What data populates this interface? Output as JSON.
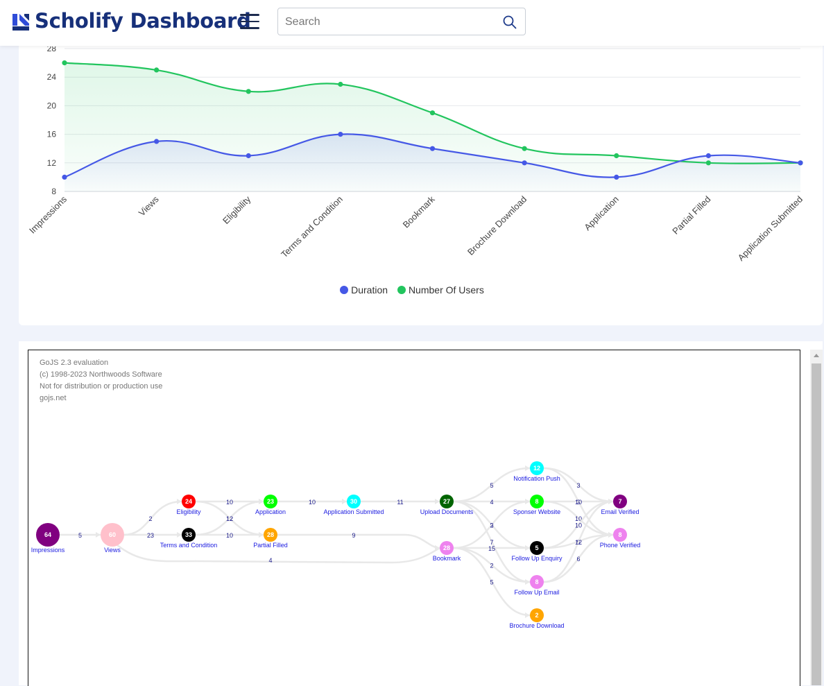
{
  "header": {
    "brand": "Scholify Dashboard",
    "search_placeholder": "Search",
    "icons": [
      "logo-icon",
      "menu-icon",
      "search-icon"
    ]
  },
  "chart_data": {
    "type": "area",
    "categories": [
      "Impressions",
      "Views",
      "Eligibility",
      "Terms and Condition",
      "Bookmark",
      "Brochure Download",
      "Application",
      "Partial Filled",
      "Application Submitted"
    ],
    "series": [
      {
        "name": "Duration",
        "color": "#4558e6",
        "values": [
          10,
          15,
          13,
          16,
          14,
          12,
          10,
          13,
          12
        ]
      },
      {
        "name": "Number Of Users",
        "color": "#22c55e",
        "values": [
          26,
          25,
          22,
          23,
          19,
          14,
          13,
          12,
          12
        ]
      }
    ],
    "y_ticks": [
      "8",
      "12",
      "16",
      "20",
      "24",
      "28"
    ],
    "ylim": [
      8,
      28
    ],
    "grid": true,
    "legend": "bottom",
    "smooth": true
  },
  "diagram": {
    "eval_note": [
      "GoJS 2.3 evaluation",
      "(c) 1998-2023 Northwoods Software",
      "Not for distribution or production use",
      "gojs.net"
    ],
    "nodes": [
      {
        "id": "impressions",
        "label": "Impressions",
        "value": "64",
        "color": "#800080",
        "big": true
      },
      {
        "id": "views",
        "label": "Views",
        "value": "60",
        "color": "#ffc0cb",
        "big": true
      },
      {
        "id": "eligibility",
        "label": "Eligibility",
        "value": "24",
        "color": "#ff0000"
      },
      {
        "id": "terms",
        "label": "Terms and Condition",
        "value": "33",
        "color": "#000000"
      },
      {
        "id": "application",
        "label": "Application",
        "value": "23",
        "color": "#00ff00"
      },
      {
        "id": "partial",
        "label": "Partial Filled",
        "value": "28",
        "color": "#ffa500"
      },
      {
        "id": "appsub",
        "label": "Application Submitted",
        "value": "30",
        "color": "#00ffff"
      },
      {
        "id": "upload",
        "label": "Upload Documents",
        "value": "27",
        "color": "#006400"
      },
      {
        "id": "bookmark",
        "label": "Bookmark",
        "value": "28",
        "color": "#ee82ee"
      },
      {
        "id": "notif",
        "label": "Notification Push",
        "value": "12",
        "color": "#00ffff"
      },
      {
        "id": "sponser",
        "label": "Sponser Website",
        "value": "8",
        "color": "#00ff00"
      },
      {
        "id": "followenq",
        "label": "Follow Up Enquiry",
        "value": "5",
        "color": "#000000"
      },
      {
        "id": "followemail",
        "label": "Follow Up Email",
        "value": "8",
        "color": "#ee82ee"
      },
      {
        "id": "brochure",
        "label": "Brochure Download",
        "value": "2",
        "color": "#ffa500"
      },
      {
        "id": "emailver",
        "label": "Email Verified",
        "value": "7",
        "color": "#800080"
      },
      {
        "id": "phonever",
        "label": "Phone Verified",
        "value": "8",
        "color": "#ee82ee"
      }
    ],
    "links": [
      {
        "from": "impressions",
        "to": "views",
        "value": "5"
      },
      {
        "from": "views",
        "to": "eligibility",
        "value": "2"
      },
      {
        "from": "views",
        "to": "terms",
        "value": "23"
      },
      {
        "from": "views",
        "to": "bookmark",
        "value": "4"
      },
      {
        "from": "eligibility",
        "to": "application",
        "value": "10"
      },
      {
        "from": "eligibility",
        "to": "partial",
        "value": "12"
      },
      {
        "from": "terms",
        "to": "application",
        "value": "12"
      },
      {
        "from": "terms",
        "to": "partial",
        "value": "10"
      },
      {
        "from": "application",
        "to": "appsub",
        "value": "10"
      },
      {
        "from": "partial",
        "to": "bookmark",
        "value": "9"
      },
      {
        "from": "appsub",
        "to": "upload",
        "value": "11"
      },
      {
        "from": "upload",
        "to": "notif",
        "value": "5"
      },
      {
        "from": "upload",
        "to": "sponser",
        "value": "4"
      },
      {
        "from": "upload",
        "to": "followenq",
        "value": "8"
      },
      {
        "from": "upload",
        "to": "followemail",
        "value": "7"
      },
      {
        "from": "bookmark",
        "to": "sponser",
        "value": "2"
      },
      {
        "from": "bookmark",
        "to": "followenq",
        "value": "15"
      },
      {
        "from": "bookmark",
        "to": "followemail",
        "value": "2"
      },
      {
        "from": "bookmark",
        "to": "brochure",
        "value": "5"
      },
      {
        "from": "notif",
        "to": "emailver",
        "value": "3"
      },
      {
        "from": "notif",
        "to": "phonever",
        "value": "9"
      },
      {
        "from": "sponser",
        "to": "emailver",
        "value": "10"
      },
      {
        "from": "sponser",
        "to": "phonever",
        "value": "10"
      },
      {
        "from": "followenq",
        "to": "emailver",
        "value": "10"
      },
      {
        "from": "followenq",
        "to": "phonever",
        "value": "6"
      },
      {
        "from": "followemail",
        "to": "emailver",
        "value": "12"
      },
      {
        "from": "followemail",
        "to": "phonever",
        "value": "6"
      }
    ]
  }
}
